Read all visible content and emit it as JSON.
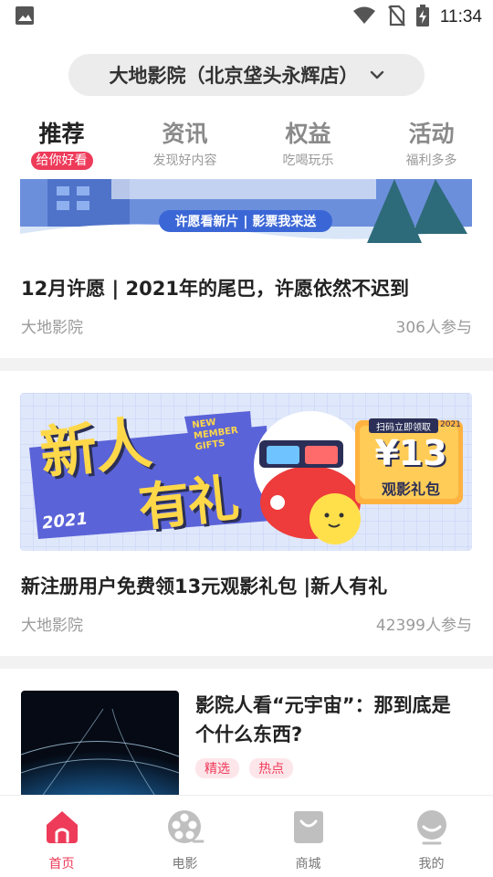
{
  "status": {
    "time": "11:34"
  },
  "header": {
    "cinema_name": "大地影院（北京垡头永辉店）"
  },
  "tabs": [
    {
      "title": "推荐",
      "sub": "给你好看",
      "active": true
    },
    {
      "title": "资讯",
      "sub": "发现好内容",
      "active": false
    },
    {
      "title": "权益",
      "sub": "吃喝玩乐",
      "active": false
    },
    {
      "title": "活动",
      "sub": "福利多多",
      "active": false
    }
  ],
  "feed": {
    "card1": {
      "banner_text": "许愿看新片 | 影票我来送",
      "title": "12月许愿 | 2021年的尾巴，许愿依然不迟到",
      "source": "大地影院",
      "participants": "306人参与"
    },
    "card2": {
      "banner": {
        "main_text_1": "新人",
        "main_text_2": "有礼",
        "year": "2021",
        "badge_line1": "NEW",
        "badge_line2": "MEMBER",
        "badge_line3": "GIFTS",
        "scan_text": "扫码立即领取",
        "price": "¥13",
        "package": "观影礼包",
        "corner_year": "2021"
      },
      "title": "新注册用户免费领13元观影礼包 |新人有礼",
      "source": "大地影院",
      "participants": "42399人参与"
    },
    "card3": {
      "title_line1": "影院人看“元宇宙”：那到底是",
      "title_line2": "个什么东西?",
      "tags": [
        "精选",
        "热点"
      ]
    }
  },
  "bottom_nav": [
    {
      "label": "首页",
      "icon": "home-icon",
      "active": true
    },
    {
      "label": "电影",
      "icon": "film-reel-icon",
      "active": false
    },
    {
      "label": "商城",
      "icon": "shopping-bag-icon",
      "active": false
    },
    {
      "label": "我的",
      "icon": "profile-icon",
      "active": false
    }
  ],
  "colors": {
    "accent": "#ee3b5a",
    "banner_blue": "#5b63d8",
    "banner_yellow": "#ffd84a"
  }
}
